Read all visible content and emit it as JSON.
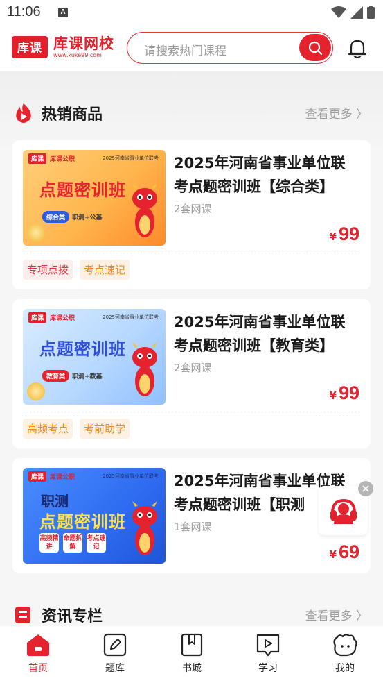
{
  "status": {
    "time": "11:06",
    "notice": "A"
  },
  "header": {
    "logo_badge": "库课",
    "logo_name": "库课网校",
    "logo_url": "www.kuke99.com",
    "search_placeholder": "请搜索热门课程"
  },
  "hot": {
    "title": "热销商品",
    "more": "查看更多 〉",
    "products": [
      {
        "title_line1": "2025年河南省事业单位联",
        "title_line2": "考点题密训班【综合类】",
        "sub": "2套网课",
        "price_symbol": "¥",
        "price": "99",
        "thumb_brand": "库课",
        "thumb_brand2": "库课公职",
        "thumb_note": "2025河南省事业单位联考",
        "thumb_headline": "点题密训班",
        "thumb_tag1": "综合类",
        "thumb_tag2": "职测+公基",
        "tags": [
          "专项点拨",
          "考点速记"
        ]
      },
      {
        "title_line1": "2025年河南省事业单位联",
        "title_line2": "考点题密训班【教育类】",
        "sub": "2套网课",
        "price_symbol": "¥",
        "price": "99",
        "thumb_brand": "库课",
        "thumb_brand2": "库课公职",
        "thumb_note": "2025河南省事业单位联考",
        "thumb_headline": "点题密训班",
        "thumb_tag1": "教育类",
        "thumb_tag2": "职测+教基",
        "tags": [
          "高频考点",
          "考前助学"
        ]
      },
      {
        "title_line1": "2025年河南省事业单位联",
        "title_line2": "考点题密训班【职测",
        "sub": "1套网课",
        "price_symbol": "¥",
        "price": "69",
        "thumb_brand": "库课",
        "thumb_brand2": "库课公职",
        "thumb_note": "2025河南省事业单位联考",
        "thumb_headline_a": "职测",
        "thumb_headline": "点题密训班",
        "thumb_chips": [
          "高频精讲",
          "命题拆解",
          "考点速记"
        ],
        "tags": []
      }
    ]
  },
  "news": {
    "title": "资讯专栏",
    "more": "查看更多 〉"
  },
  "tabbar": {
    "items": [
      {
        "label": "首页",
        "icon": "home-icon",
        "active": true
      },
      {
        "label": "题库",
        "icon": "edit-icon",
        "active": false
      },
      {
        "label": "书城",
        "icon": "bookmark-icon",
        "active": false
      },
      {
        "label": "学习",
        "icon": "play-icon",
        "active": false
      },
      {
        "label": "我的",
        "icon": "mascot-icon",
        "active": false
      }
    ]
  },
  "colors": {
    "brand_red": "#e5232f",
    "tag_red_bg": "#fdeeee",
    "tag_orange_text": "#f08a1c"
  }
}
